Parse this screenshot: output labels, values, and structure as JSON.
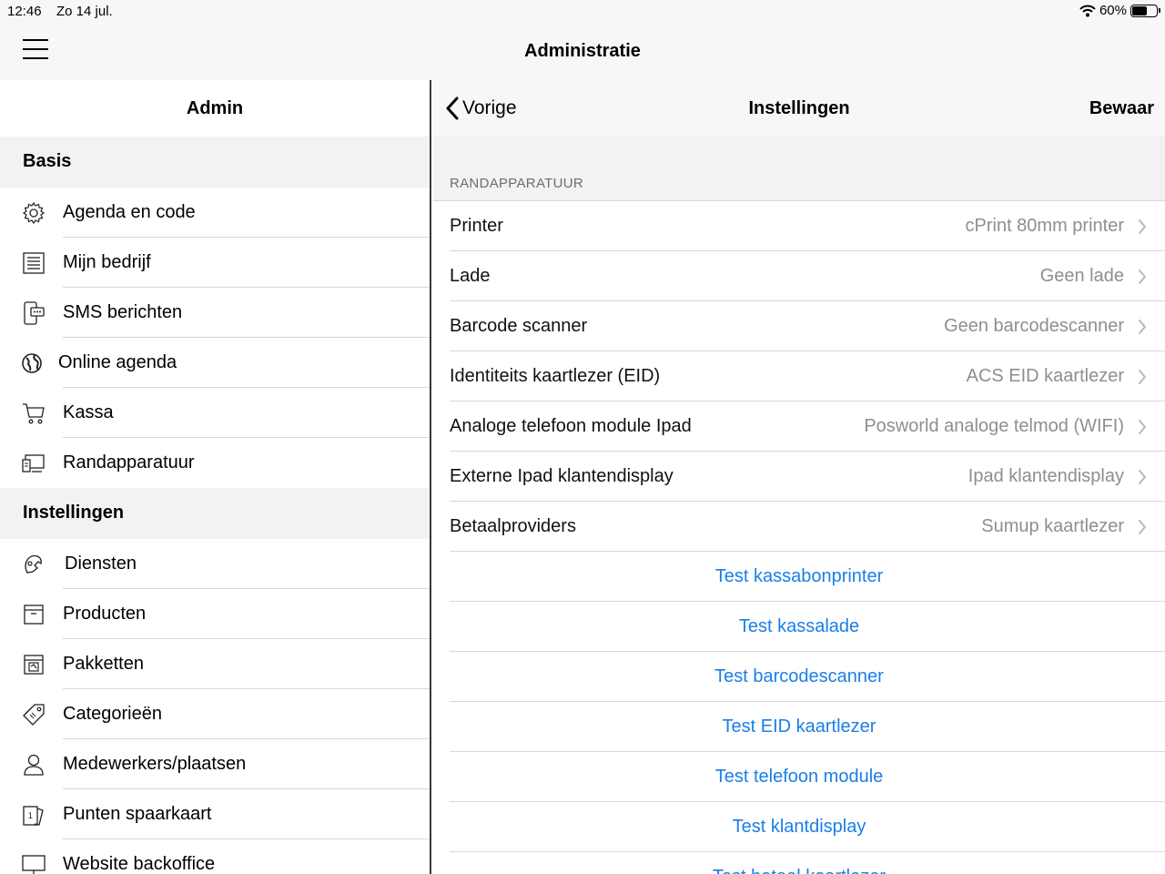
{
  "status": {
    "time": "12:46",
    "date": "Zo 14 jul.",
    "battery": "60%",
    "battery_level": 0.6
  },
  "topbar": {
    "title": "Administratie"
  },
  "sidebar": {
    "title": "Admin",
    "sections": [
      {
        "label": "Basis"
      },
      {
        "label": "Instellingen"
      }
    ],
    "basis_items": [
      {
        "label": "Agenda en code",
        "icon": "gear-icon"
      },
      {
        "label": "Mijn bedrijf",
        "icon": "document-icon"
      },
      {
        "label": "SMS berichten",
        "icon": "sms-icon"
      },
      {
        "label": "Online agenda",
        "icon": "globe-icon"
      },
      {
        "label": "Kassa",
        "icon": "cart-icon"
      },
      {
        "label": "Randapparatuur",
        "icon": "devices-icon"
      }
    ],
    "settings_items": [
      {
        "label": "Diensten",
        "icon": "services-icon"
      },
      {
        "label": "Producten",
        "icon": "box-icon"
      },
      {
        "label": "Pakketten",
        "icon": "package-icon"
      },
      {
        "label": "Categorieën",
        "icon": "tags-icon"
      },
      {
        "label": "Medewerkers/plaatsen",
        "icon": "person-icon"
      },
      {
        "label": "Punten spaarkaart",
        "icon": "card-icon"
      },
      {
        "label": "Website backoffice",
        "icon": "monitor-icon"
      }
    ]
  },
  "main": {
    "back_label": "Vorige",
    "title": "Instellingen",
    "save_label": "Bewaar",
    "group_header": "RANDAPPARATUUR",
    "rows": [
      {
        "label": "Printer",
        "value": "cPrint 80mm printer"
      },
      {
        "label": "Lade",
        "value": "Geen lade"
      },
      {
        "label": "Barcode scanner",
        "value": "Geen barcodescanner"
      },
      {
        "label": "Identiteits kaartlezer (EID)",
        "value": "ACS EID kaartlezer"
      },
      {
        "label": "Analoge telefoon module Ipad",
        "value": "Posworld analoge telmod (WIFI)"
      },
      {
        "label": "Externe Ipad klantendisplay",
        "value": "Ipad klantendisplay"
      },
      {
        "label": "Betaalproviders",
        "value": "Sumup kaartlezer"
      }
    ],
    "actions": [
      "Test kassabonprinter",
      "Test kassalade",
      "Test barcodescanner",
      "Test EID kaartlezer",
      "Test telefoon module",
      "Test klantdisplay",
      "Test betaal kaartlezer"
    ],
    "accent_color": "#1a7ee8"
  }
}
